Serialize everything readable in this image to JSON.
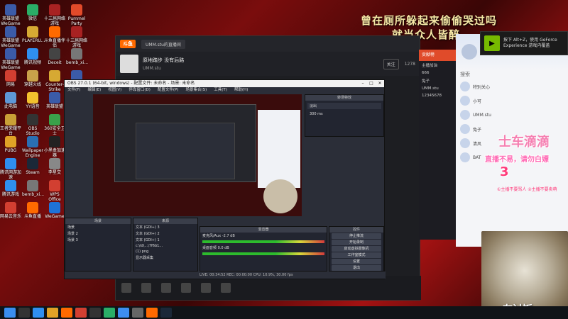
{
  "caption": {
    "line1": "曾在厕所躲起来偷偷哭过吗",
    "line2": "就当众人皆醉"
  },
  "toast": {
    "text": "按下 Alt+Z，使用 GeForce Experience 游戏内覆盖"
  },
  "desktop_icons": [
    {
      "label": "英雄联盟WeGame版",
      "color": "#3b5ba8"
    },
    {
      "label": "微信",
      "color": "#2aae67"
    },
    {
      "label": "十三届网络游戏",
      "color": "#a82222"
    },
    {
      "label": "Pummel Party",
      "color": "#e24a2a"
    },
    {
      "label": "英雄联盟WeGame版",
      "color": "#3b5ba8"
    },
    {
      "label": "PLAYERU...",
      "color": "#d6a933"
    },
    {
      "label": "斗鱼直播伴侣",
      "color": "#ff6a00"
    },
    {
      "label": "十三届网络游戏",
      "color": "#a82222"
    },
    {
      "label": "英雄联盟WeGame版",
      "color": "#3b5ba8"
    },
    {
      "label": "腾讯视频",
      "color": "#2f8ff0"
    },
    {
      "label": "Deceit",
      "color": "#444"
    },
    {
      "label": "bemb_xi...",
      "color": "#777"
    },
    {
      "label": "网易",
      "color": "#d23f31"
    },
    {
      "label": "穿越火线",
      "color": "#c8a24a"
    },
    {
      "label": "Counter-Strike",
      "color": "#d6a933"
    },
    {
      "label": "英雄联盟",
      "color": "#3b5ba8"
    },
    {
      "label": "此电脑",
      "color": "#5e98d6"
    },
    {
      "label": "YY语音",
      "color": "#f2c12e"
    },
    {
      "label": "英雄联盟",
      "color": "#3b5ba8"
    },
    {
      "label": "360安全浏览",
      "color": "#3aa14a"
    },
    {
      "label": "王者荣耀平台",
      "color": "#c9a036"
    },
    {
      "label": "OBS Studio",
      "color": "#333"
    },
    {
      "label": "360安全卫士",
      "color": "#3aa14a"
    },
    {
      "label": "腾讯游戏",
      "color": "#2f8ff0"
    },
    {
      "label": "PUBG",
      "color": "#e0a226"
    },
    {
      "label": "Wallpaper Engine",
      "color": "#2a6fb3"
    },
    {
      "label": "小黑盒加速器",
      "color": "#222"
    },
    {
      "label": "QQ游戏",
      "color": "#3d8ef0"
    },
    {
      "label": "腾讯网游加速",
      "color": "#2f8ff0"
    },
    {
      "label": "Steam",
      "color": "#1b2838"
    },
    {
      "label": "李星交",
      "color": "#888"
    },
    {
      "label": "照片",
      "color": "#2f8ff0"
    },
    {
      "label": "腾讯游戏",
      "color": "#2f8ff0"
    },
    {
      "label": "bemb_xi...",
      "color": "#777"
    },
    {
      "label": "WPS Office",
      "color": "#d23f31"
    },
    {
      "label": "YY游戏大厅",
      "color": "#f2c12e"
    },
    {
      "label": "网易云音乐",
      "color": "#d23f31"
    },
    {
      "label": "斗鱼直播",
      "color": "#ff6a00"
    },
    {
      "label": "WeGame",
      "color": "#1e72d8"
    },
    {
      "label": "10金币记",
      "color": "#999"
    }
  ],
  "douyu": {
    "logo": "斗鱼",
    "tab": "UMM.stu的直播间",
    "room_title": "原地踏步 没有后路",
    "room_meta": "UMM.stu",
    "follow": "关注",
    "count": "1278"
  },
  "obs": {
    "title": "OBS 27.0.1 (64-bit, windows) - 配置文件: 未命名 - 场景: 未命名",
    "menu": [
      "文件(F)",
      "编辑(E)",
      "视图(V)",
      "停靠窗口(D)",
      "配置文件(P)",
      "场景集合(S)",
      "工具(T)",
      "帮助(H)"
    ],
    "scenes_header": "场景",
    "scenes": [
      "场景",
      "场景 2",
      "场景 3"
    ],
    "sources_header": "来源",
    "sources": [
      "文本 (GDI+) 3",
      "文本 (GDI+) 2",
      "文本 (GDI+) 1",
      "c:\\ld\\...\\7f6b1...",
      "(1) png",
      "显示器采集"
    ],
    "mixer_header": "混音器",
    "mixer_tracks": [
      {
        "name": "麦克风/Aux",
        "db": "-2.7 dB"
      },
      {
        "name": "桌面音频",
        "db": "0.0 dB"
      }
    ],
    "controls_header": "控件",
    "controls": [
      "停止推流",
      "开始录制",
      "启动虚拟摄像机",
      "工作室模式",
      "设置",
      "退出"
    ],
    "status": "LIVE: 00:34:52   REC: 00:00:00   CPU: 10.9%, 30.00 fps",
    "right_panel_title": "转场特效",
    "right_panel_field": "淡出",
    "right_panel_duration": "300 ms"
  },
  "chat": {
    "header": "贡献榜",
    "messages": [
      "主播加油",
      "666",
      "兔子",
      "UMM.stu",
      "12345678"
    ]
  },
  "qq": {
    "contacts": [
      "特别关心",
      "小可",
      "UMM.stu",
      "兔子",
      "清风",
      "BAT"
    ],
    "search": "搜索"
  },
  "overlay": {
    "brand": "士车滴滴",
    "slogan": "直播不易，请勿白嫖",
    "num": "3",
    "rules": "①主播不要骂人 ②主播不要卖萌",
    "cam_caption": "在讨饭"
  }
}
